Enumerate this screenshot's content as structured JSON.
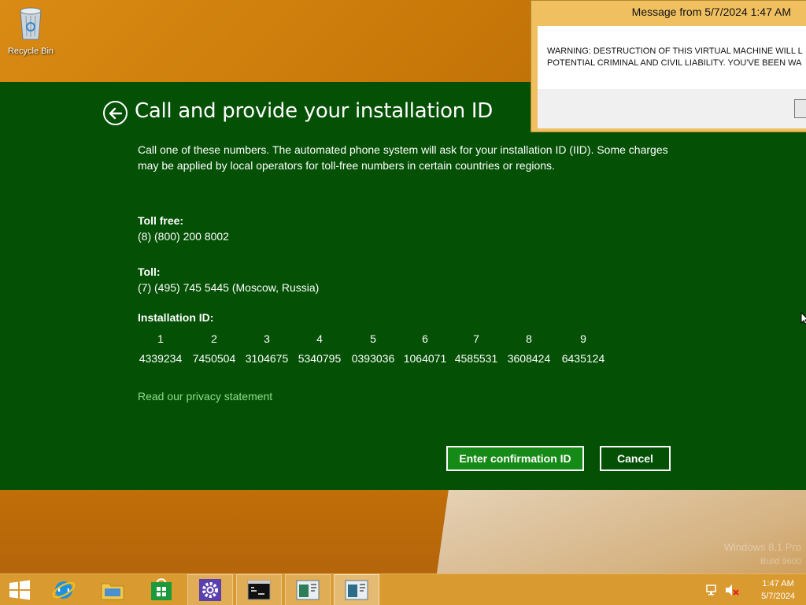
{
  "desktop": {
    "recycle_bin_label": "Recycle Bin",
    "watermark_line1": "Windows 8.1 Pro",
    "watermark_line2": "Build 9600"
  },
  "activation": {
    "title": "Call and provide your installation ID",
    "description": "Call one of these numbers. The automated phone system will ask for your installation ID (IID). Some charges may be applied by local operators for toll-free numbers in certain countries or regions.",
    "toll_free_label": "Toll free:",
    "toll_free_number": "(8) (800) 200 8002",
    "toll_label": "Toll:",
    "toll_number": "(7) (495) 745 5445 (Moscow, Russia)",
    "installation_id_label": "Installation ID:",
    "installation_id": [
      {
        "n": "1",
        "v": "4339234"
      },
      {
        "n": "2",
        "v": "7450504"
      },
      {
        "n": "3",
        "v": "3104675"
      },
      {
        "n": "4",
        "v": "5340795"
      },
      {
        "n": "5",
        "v": "0393036"
      },
      {
        "n": "6",
        "v": "1064071"
      },
      {
        "n": "7",
        "v": "4585531"
      },
      {
        "n": "8",
        "v": "3608424"
      },
      {
        "n": "9",
        "v": "6435124"
      }
    ],
    "privacy_link": "Read our privacy statement",
    "confirm_button": "Enter confirmation ID",
    "cancel_button": "Cancel",
    "panel_color": "#045005",
    "primary_button_color": "#168a16",
    "link_color": "#8fdc8a"
  },
  "message": {
    "title": "Message from  5/7/2024 1:47 AM",
    "line1": "WARNING: DESTRUCTION OF THIS VIRTUAL MACHINE WILL L",
    "line2": "POTENTIAL CRIMINAL AND CIVIL LIABILITY. YOU'VE BEEN WA"
  },
  "taskbar": {
    "items": [
      "start",
      "internet-explorer",
      "file-explorer",
      "store",
      "settings",
      "command-prompt",
      "window-app",
      "window-app-active"
    ],
    "clock_time": "1:47 AM",
    "clock_date": "5/7/2024"
  }
}
